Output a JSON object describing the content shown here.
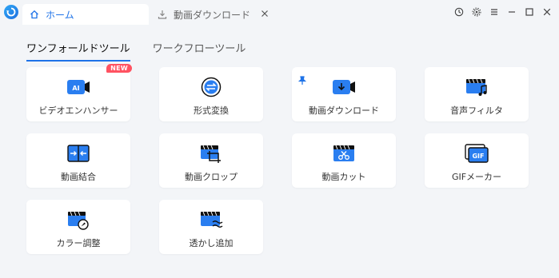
{
  "titlebar": {
    "tabs": [
      {
        "label": "ホーム",
        "icon": "home-icon",
        "active": true
      },
      {
        "label": "動画ダウンロード",
        "icon": "download-icon",
        "active": false
      }
    ],
    "controls": [
      "history-icon",
      "settings-gear-icon",
      "menu-icon",
      "minimize-icon",
      "maximize-icon",
      "close-icon"
    ]
  },
  "subtabs": [
    {
      "label": "ワンフォールドツール",
      "active": true
    },
    {
      "label": "ワークフローツール",
      "active": false
    }
  ],
  "tools": [
    {
      "label": "ビデオエンハンサー",
      "icon": "ai-enhance-icon",
      "badge": "NEW"
    },
    {
      "label": "形式変換",
      "icon": "convert-icon"
    },
    {
      "label": "動画ダウンロード",
      "icon": "video-download-icon",
      "pinned": true
    },
    {
      "label": "音声フィルタ",
      "icon": "audio-filter-icon"
    },
    {
      "label": "動画結合",
      "icon": "merge-icon"
    },
    {
      "label": "動画クロップ",
      "icon": "crop-icon"
    },
    {
      "label": "動画カット",
      "icon": "cut-icon"
    },
    {
      "label": "GIFメーカー",
      "icon": "gif-icon",
      "icon_text": "GIF"
    },
    {
      "label": "カラー調整",
      "icon": "color-adjust-icon"
    },
    {
      "label": "透かし追加",
      "icon": "watermark-icon"
    }
  ],
  "colors": {
    "accent": "#1f73e8",
    "badge": "#ff5261",
    "background": "#f3f5f8",
    "card": "#ffffff"
  }
}
